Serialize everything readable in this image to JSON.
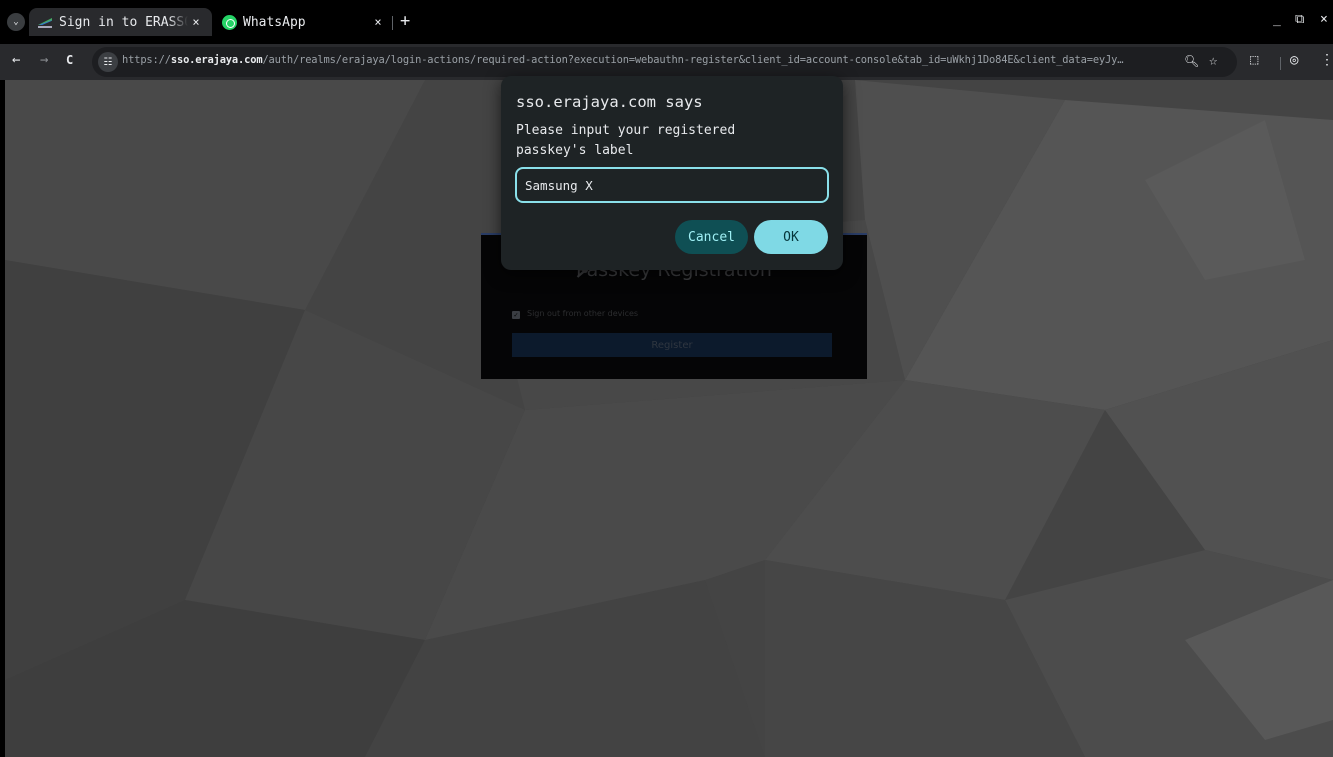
{
  "browser": {
    "tabs": [
      {
        "title": "Sign in to ERASSO",
        "close": "×",
        "active": true,
        "favicon": "erajaya-favicon"
      },
      {
        "title": "WhatsApp",
        "close": "×",
        "active": false,
        "favicon": "whatsapp-favicon"
      }
    ],
    "new_tab": "+",
    "tab_menu_icon": "⌄",
    "window_controls": {
      "minimize": "_",
      "restore": "⧉",
      "close": "×"
    },
    "nav": {
      "back": "←",
      "forward": "→",
      "reload": "C"
    },
    "url": {
      "scheme": "https://",
      "host": "sso.erajaya.com",
      "path": "/auth/realms/erajaya/login-actions/required-action?execution=webauthn-register&client_id=account-console&tab_id=uWkhj1Do84E&client_data=eyJy…"
    },
    "omnibox_icons": {
      "site_info": "☷",
      "zoom": "🔍︎",
      "bookmark": "☆"
    },
    "toolbar_icons": {
      "extensions": "⬚",
      "profile": "◎",
      "menu": "⋮"
    }
  },
  "page": {
    "card_title": "Passkey Registration",
    "sign_out_label": "Sign out from other devices",
    "sign_out_checked": true,
    "register_label": "Register",
    "colors": {
      "background": "#444444",
      "card": "#050506",
      "register": "#0c1a2c"
    }
  },
  "dialog": {
    "title": "sso.erajaya.com says",
    "message": "Please input your registered\npasskey's label",
    "input_value": "Samsung X",
    "cancel_label": "Cancel",
    "ok_label": "OK",
    "colors": {
      "surface": "#1e2325",
      "accent": "#7fd9e5",
      "focus_border": "#8ae0ea"
    }
  }
}
